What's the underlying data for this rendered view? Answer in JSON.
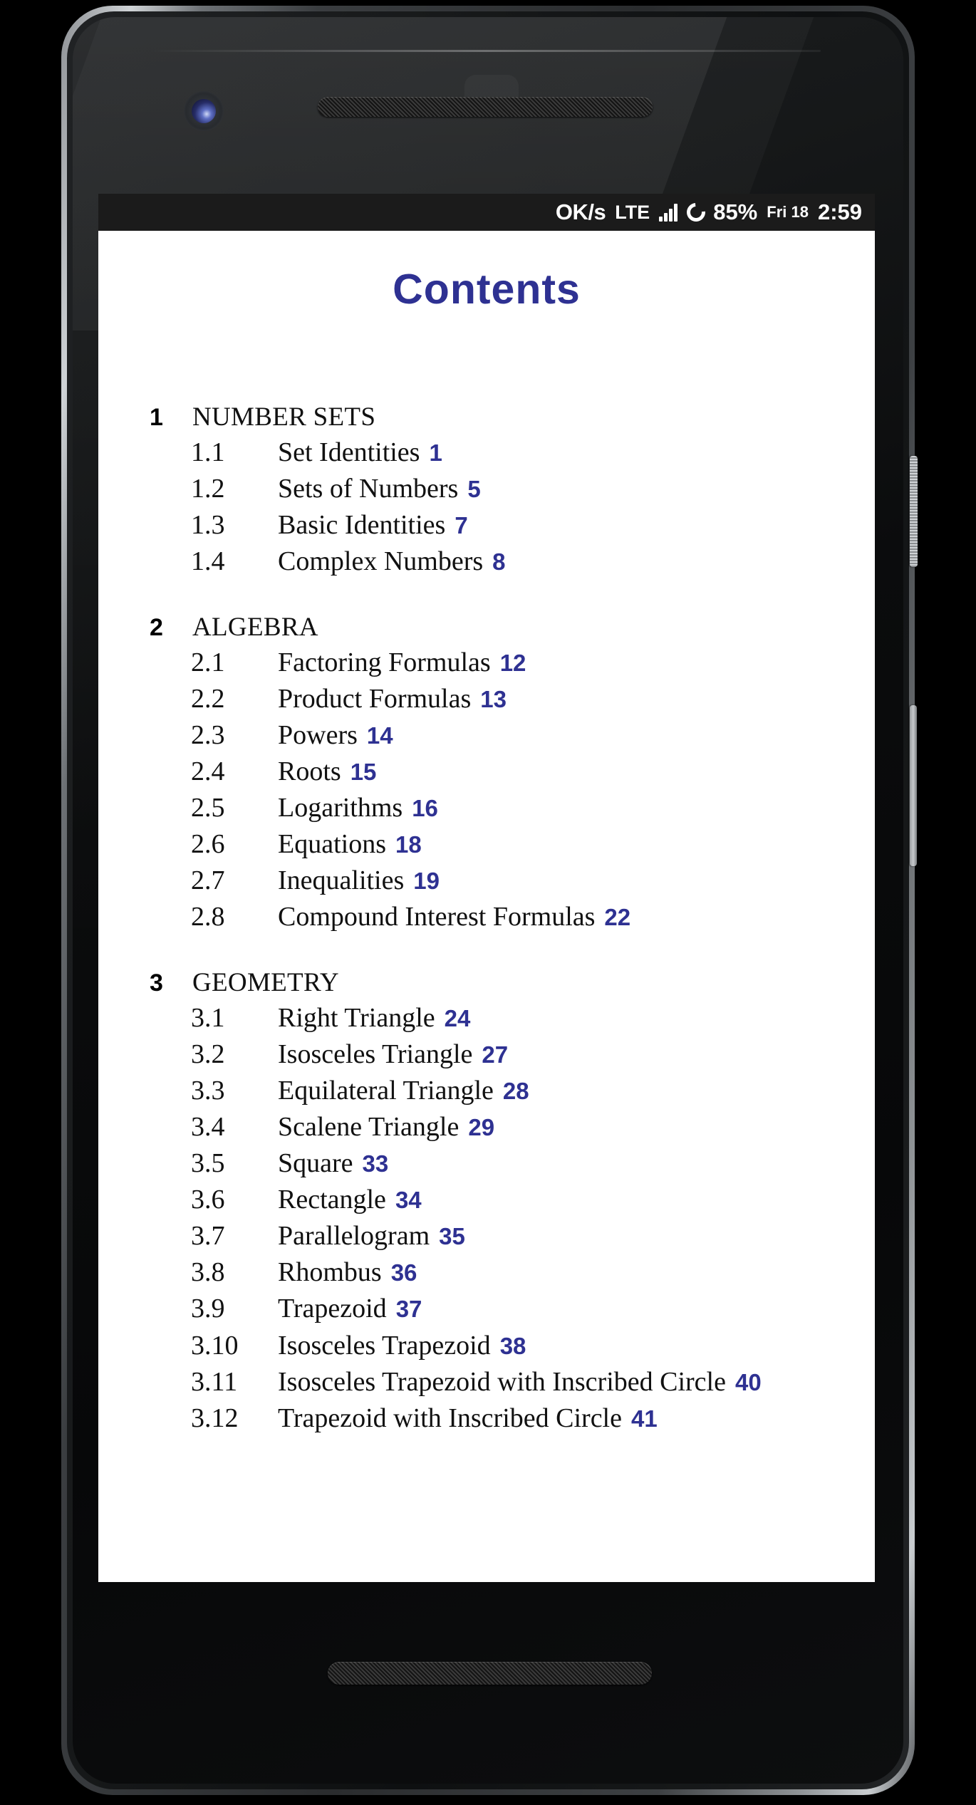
{
  "device": {
    "name": "android-phone-mockup",
    "hardware": {
      "front_camera": "camera-icon",
      "earpiece_speaker": "speaker-grille-icon",
      "proximity_sensor": "proximity-sensor-icon",
      "bottom_speaker": "speaker-grille-icon",
      "power_button": "power-button",
      "volume_button": "volume-rocker-button"
    }
  },
  "status_bar": {
    "network_speed": "OK/s",
    "network_type": "LTE",
    "signal_icon": "signal-bars-icon",
    "sync_icon": "sync-ring-icon",
    "battery": "85%",
    "date": "Fri 18",
    "time": "2:59"
  },
  "document": {
    "title": "Contents",
    "title_color": "#2e3192",
    "page_number_color": "#2e3192",
    "background_color": "#ffffff",
    "chapters": [
      {
        "number": "1",
        "title": "NUMBER SETS",
        "sections": [
          {
            "number": "1.1",
            "title": "Set Identities",
            "page": "1"
          },
          {
            "number": "1.2",
            "title": "Sets of Numbers",
            "page": "5"
          },
          {
            "number": "1.3",
            "title": "Basic Identities",
            "page": "7"
          },
          {
            "number": "1.4",
            "title": "Complex Numbers",
            "page": "8"
          }
        ]
      },
      {
        "number": "2",
        "title": "ALGEBRA",
        "sections": [
          {
            "number": "2.1",
            "title": "Factoring Formulas",
            "page": "12"
          },
          {
            "number": "2.2",
            "title": "Product Formulas",
            "page": "13"
          },
          {
            "number": "2.3",
            "title": "Powers",
            "page": "14"
          },
          {
            "number": "2.4",
            "title": "Roots",
            "page": "15"
          },
          {
            "number": "2.5",
            "title": "Logarithms",
            "page": "16"
          },
          {
            "number": "2.6",
            "title": "Equations",
            "page": "18"
          },
          {
            "number": "2.7",
            "title": "Inequalities",
            "page": "19"
          },
          {
            "number": "2.8",
            "title": "Compound Interest Formulas",
            "page": "22"
          }
        ]
      },
      {
        "number": "3",
        "title": "GEOMETRY",
        "sections": [
          {
            "number": "3.1",
            "title": "Right Triangle",
            "page": "24"
          },
          {
            "number": "3.2",
            "title": "Isosceles Triangle",
            "page": "27"
          },
          {
            "number": "3.3",
            "title": "Equilateral Triangle",
            "page": "28"
          },
          {
            "number": "3.4",
            "title": "Scalene Triangle",
            "page": "29"
          },
          {
            "number": "3.5",
            "title": "Square",
            "page": "33"
          },
          {
            "number": "3.6",
            "title": "Rectangle",
            "page": "34"
          },
          {
            "number": "3.7",
            "title": "Parallelogram",
            "page": "35"
          },
          {
            "number": "3.8",
            "title": "Rhombus",
            "page": "36"
          },
          {
            "number": "3.9",
            "title": "Trapezoid",
            "page": "37"
          },
          {
            "number": "3.10",
            "title": "Isosceles Trapezoid",
            "page": "38"
          },
          {
            "number": "3.11",
            "title": "Isosceles Trapezoid with Inscribed Circle",
            "page": "40"
          },
          {
            "number": "3.12",
            "title": "Trapezoid with Inscribed Circle",
            "page": "41"
          }
        ]
      }
    ]
  }
}
